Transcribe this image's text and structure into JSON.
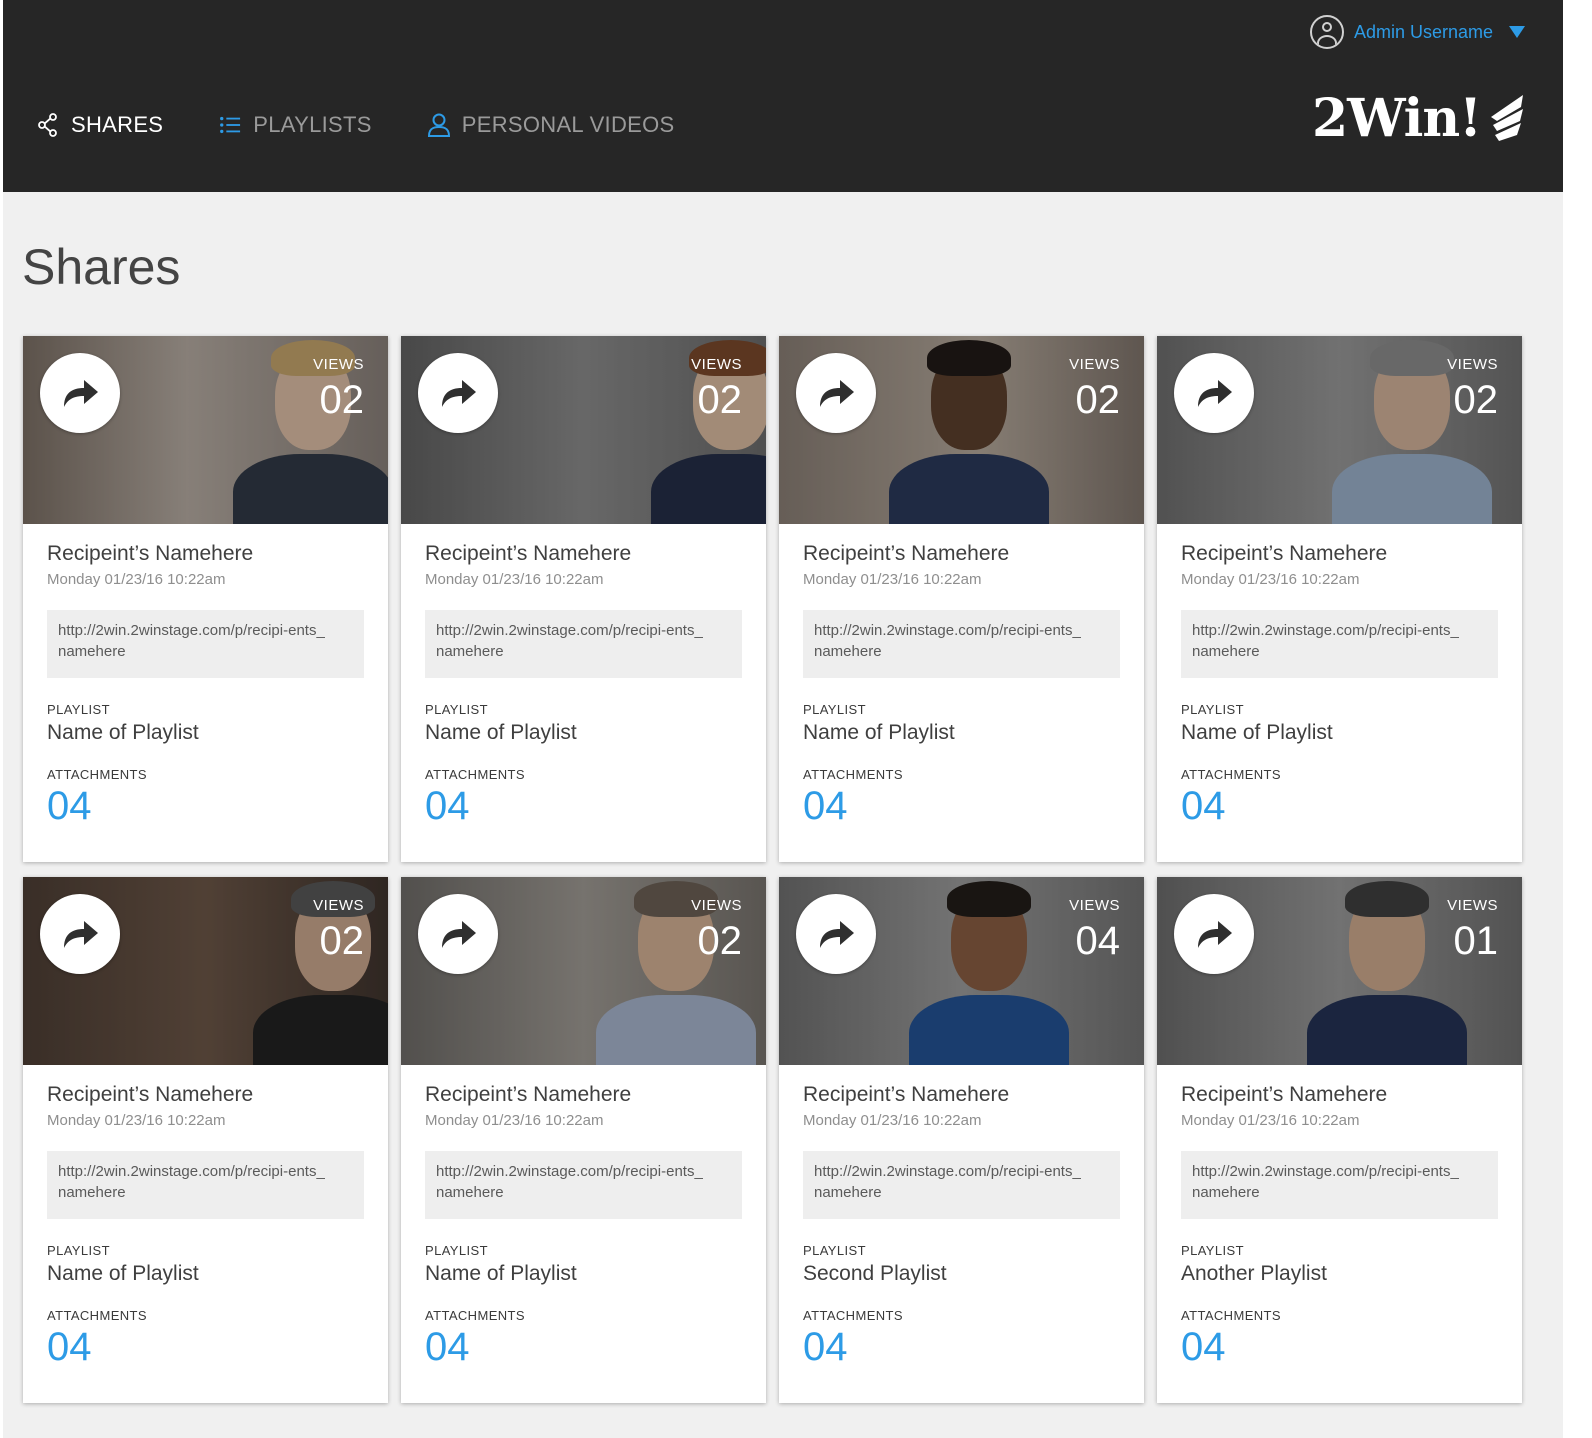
{
  "header": {
    "username": "Admin Username",
    "nav": [
      {
        "label": "SHARES",
        "icon": "share-icon"
      },
      {
        "label": "PLAYLISTS",
        "icon": "list-icon"
      },
      {
        "label": "PERSONAL VIDEOS",
        "icon": "person-icon"
      }
    ],
    "logo": "2Win!"
  },
  "page": {
    "title": "Shares"
  },
  "labels": {
    "views": "VIEWS",
    "playlist": "PLAYLIST",
    "attachments": "ATTACHMENTS"
  },
  "colors": {
    "accent": "#2d9be6",
    "header_bg": "#262626",
    "page_bg": "#f0f0f0"
  },
  "cards": [
    {
      "recipient": "Recipeint’s Namehere",
      "date": "Monday 01/23/16 10:22am",
      "link": "http://2win.2winstage.com/p/recipi-ents_namehere",
      "playlist": "Name of Playlist",
      "attachments": "04",
      "views": "02"
    },
    {
      "recipient": "Recipeint’s Namehere",
      "date": "Monday 01/23/16 10:22am",
      "link": "http://2win.2winstage.com/p/recipi-ents_namehere",
      "playlist": "Name of Playlist",
      "attachments": "04",
      "views": "02"
    },
    {
      "recipient": "Recipeint’s Namehere",
      "date": "Monday 01/23/16 10:22am",
      "link": "http://2win.2winstage.com/p/recipi-ents_namehere",
      "playlist": "Name of Playlist",
      "attachments": "04",
      "views": "02"
    },
    {
      "recipient": "Recipeint’s Namehere",
      "date": "Monday 01/23/16 10:22am",
      "link": "http://2win.2winstage.com/p/recipi-ents_namehere",
      "playlist": "Name of Playlist",
      "attachments": "04",
      "views": "02"
    },
    {
      "recipient": "Recipeint’s Namehere",
      "date": "Monday 01/23/16 10:22am",
      "link": "http://2win.2winstage.com/p/recipi-ents_namehere",
      "playlist": "Name of Playlist",
      "attachments": "04",
      "views": "02"
    },
    {
      "recipient": "Recipeint’s Namehere",
      "date": "Monday 01/23/16 10:22am",
      "link": "http://2win.2winstage.com/p/recipi-ents_namehere",
      "playlist": "Name of Playlist",
      "attachments": "04",
      "views": "02"
    },
    {
      "recipient": "Recipeint’s Namehere",
      "date": "Monday 01/23/16 10:22am",
      "link": "http://2win.2winstage.com/p/recipi-ents_namehere",
      "playlist": "Second Playlist",
      "attachments": "04",
      "views": "04"
    },
    {
      "recipient": "Recipeint’s Namehere",
      "date": "Monday 01/23/16 10:22am",
      "link": "http://2win.2winstage.com/p/recipi-ents_namehere",
      "playlist": "Another Playlist",
      "attachments": "04",
      "views": "01"
    }
  ]
}
